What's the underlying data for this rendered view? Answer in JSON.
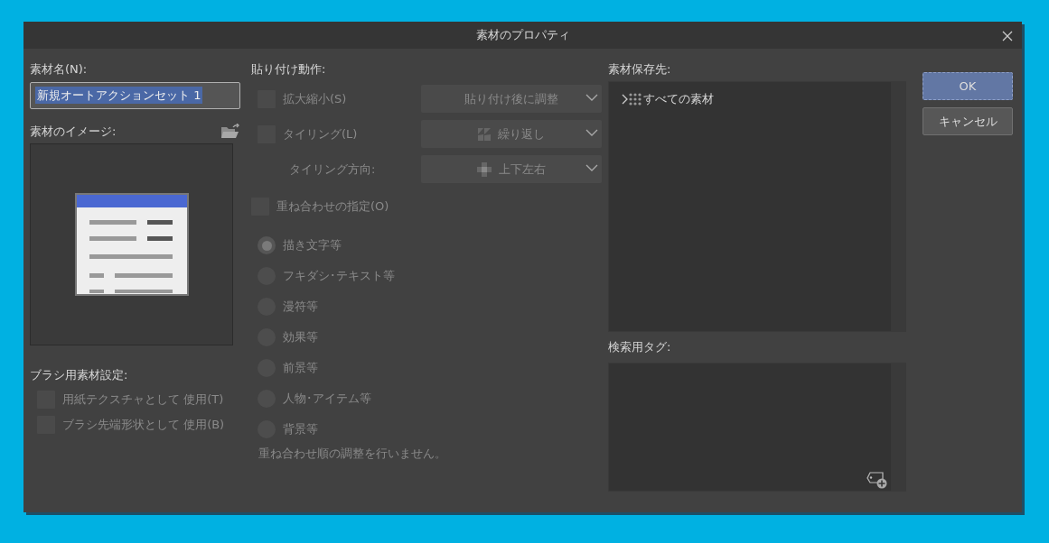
{
  "window": {
    "title": "素材のプロパティ"
  },
  "name_field": {
    "label": "素材名(N):",
    "value": "新規オートアクションセット 1",
    "selected": true
  },
  "image": {
    "label": "素材のイメージ:"
  },
  "brush_settings": {
    "label": "ブラシ用素材設定:",
    "options": [
      {
        "label": "用紙テクスチャとして 使用(T)",
        "checked": false,
        "disabled": true
      },
      {
        "label": "ブラシ先端形状として 使用(B)",
        "checked": false,
        "disabled": true
      }
    ]
  },
  "paste": {
    "label": "貼り付け動作:",
    "options": [
      {
        "label": "拡大縮小(S)",
        "checked": false,
        "disabled": true,
        "dropdown": "貼り付け後に調整"
      },
      {
        "label": "タイリング(L)",
        "checked": false,
        "disabled": true,
        "dropdown": "繰り返し"
      }
    ],
    "direction": {
      "label": "タイリング方向:",
      "value": "上下左右",
      "disabled": true
    },
    "overlay": {
      "label": "重ね合わせの指定(O)",
      "checked": false,
      "disabled": true
    },
    "layers": [
      {
        "label": "描き文字等",
        "selected": true
      },
      {
        "label": "フキダシ･テキスト等",
        "selected": false
      },
      {
        "label": "漫符等",
        "selected": false
      },
      {
        "label": "効果等",
        "selected": false
      },
      {
        "label": "前景等",
        "selected": false
      },
      {
        "label": "人物･アイテム等",
        "selected": false
      },
      {
        "label": "背景等",
        "selected": false
      }
    ],
    "note": "重ね合わせ順の調整を行いません。"
  },
  "destination": {
    "label": "素材保存先:",
    "tree": [
      {
        "label": "すべての素材",
        "expanded": false
      }
    ]
  },
  "tags": {
    "label": "検索用タグ:"
  },
  "buttons": [
    {
      "label": "OK",
      "primary": true
    },
    {
      "label": "キャンセル",
      "primary": false
    }
  ]
}
